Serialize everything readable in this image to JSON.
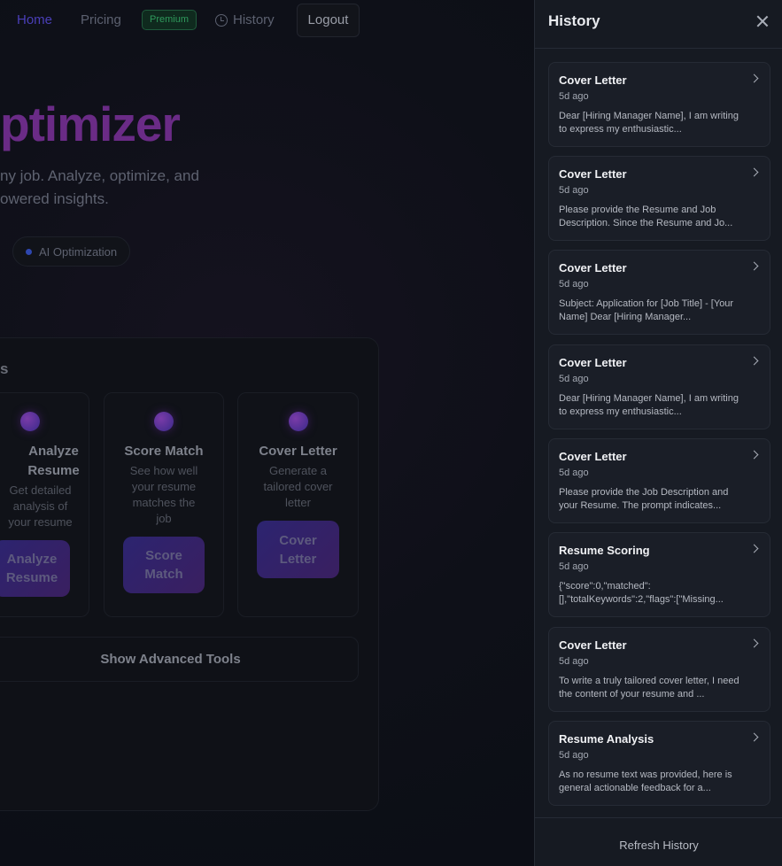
{
  "nav": {
    "home": "Home",
    "pricing": "Pricing",
    "premium_badge": "Premium",
    "history": "History",
    "logout": "Logout"
  },
  "hero": {
    "title": "ptimizer",
    "subtitle_line1": "ny job. Analyze, optimize, and",
    "subtitle_line2": "owered insights.",
    "pill": "AI Optimization"
  },
  "tools": {
    "heading": "s",
    "cards": [
      {
        "title": "Analyze Resume",
        "desc": "Get detailed analysis of your resume",
        "button": "Analyze Resume"
      },
      {
        "title": "Score Match",
        "desc": "See how well your resume matches the job",
        "button": "Score Match"
      },
      {
        "title": "Cover Letter",
        "desc": "Generate a tailored cover letter",
        "button": "Cover Letter"
      }
    ],
    "advanced": "Show Advanced Tools"
  },
  "drawer": {
    "title": "History",
    "refresh": "Refresh History",
    "items": [
      {
        "title": "Cover Letter",
        "time": "5d ago",
        "preview": "Dear [Hiring Manager Name], I am writing to express my enthusiastic..."
      },
      {
        "title": "Cover Letter",
        "time": "5d ago",
        "preview": "Please provide the Resume and Job Description. Since the Resume and Jo..."
      },
      {
        "title": "Cover Letter",
        "time": "5d ago",
        "preview": "Subject: Application for [Job Title] - [Your Name] Dear [Hiring Manager..."
      },
      {
        "title": "Cover Letter",
        "time": "5d ago",
        "preview": "Dear [Hiring Manager Name], I am writing to express my enthusiastic..."
      },
      {
        "title": "Cover Letter",
        "time": "5d ago",
        "preview": "Please provide the Job Description and your Resume. The prompt indicates..."
      },
      {
        "title": "Resume Scoring",
        "time": "5d ago",
        "preview": "{\"score\":0,\"matched\":[],\"totalKeywords\":2,\"flags\":[\"Missing..."
      },
      {
        "title": "Cover Letter",
        "time": "5d ago",
        "preview": "To write a truly tailored cover letter, I need the content of your resume and ..."
      },
      {
        "title": "Resume Analysis",
        "time": "5d ago",
        "preview": "As no resume text was provided, here is general actionable feedback for a..."
      }
    ]
  }
}
